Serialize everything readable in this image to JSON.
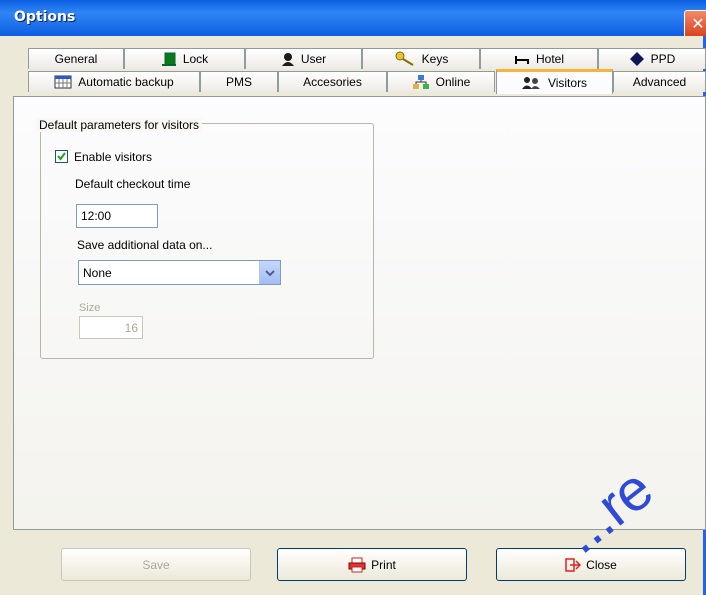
{
  "window": {
    "title": "Options"
  },
  "tabs_row1": [
    {
      "label": "General",
      "icon": "none"
    },
    {
      "label": "Lock",
      "icon": "lock-icon"
    },
    {
      "label": "User",
      "icon": "user-icon"
    },
    {
      "label": "Keys",
      "icon": "keys-icon"
    },
    {
      "label": "Hotel",
      "icon": "bed-icon"
    },
    {
      "label": "PPD",
      "icon": "ppd-icon"
    }
  ],
  "tabs_row2": [
    {
      "label": "Automatic backup",
      "icon": "calendar-icon"
    },
    {
      "label": "PMS",
      "icon": "none"
    },
    {
      "label": "Accesories",
      "icon": "none"
    },
    {
      "label": "Online",
      "icon": "network-icon"
    },
    {
      "label": "Visitors",
      "icon": "visitors-icon",
      "active": true
    },
    {
      "label": "Advanced",
      "icon": "none"
    }
  ],
  "visitors": {
    "group_label": "Default parameters for visitors",
    "enable_label": "Enable visitors",
    "enable_checked": true,
    "checkout_label": "Default checkout time",
    "checkout_value": "12:00",
    "save_label": "Save additional data on...",
    "save_value": "None",
    "size_label": "Size",
    "size_value": "16"
  },
  "buttons": {
    "save": "Save",
    "print": "Print",
    "close": "Close"
  },
  "watermark": "...re"
}
